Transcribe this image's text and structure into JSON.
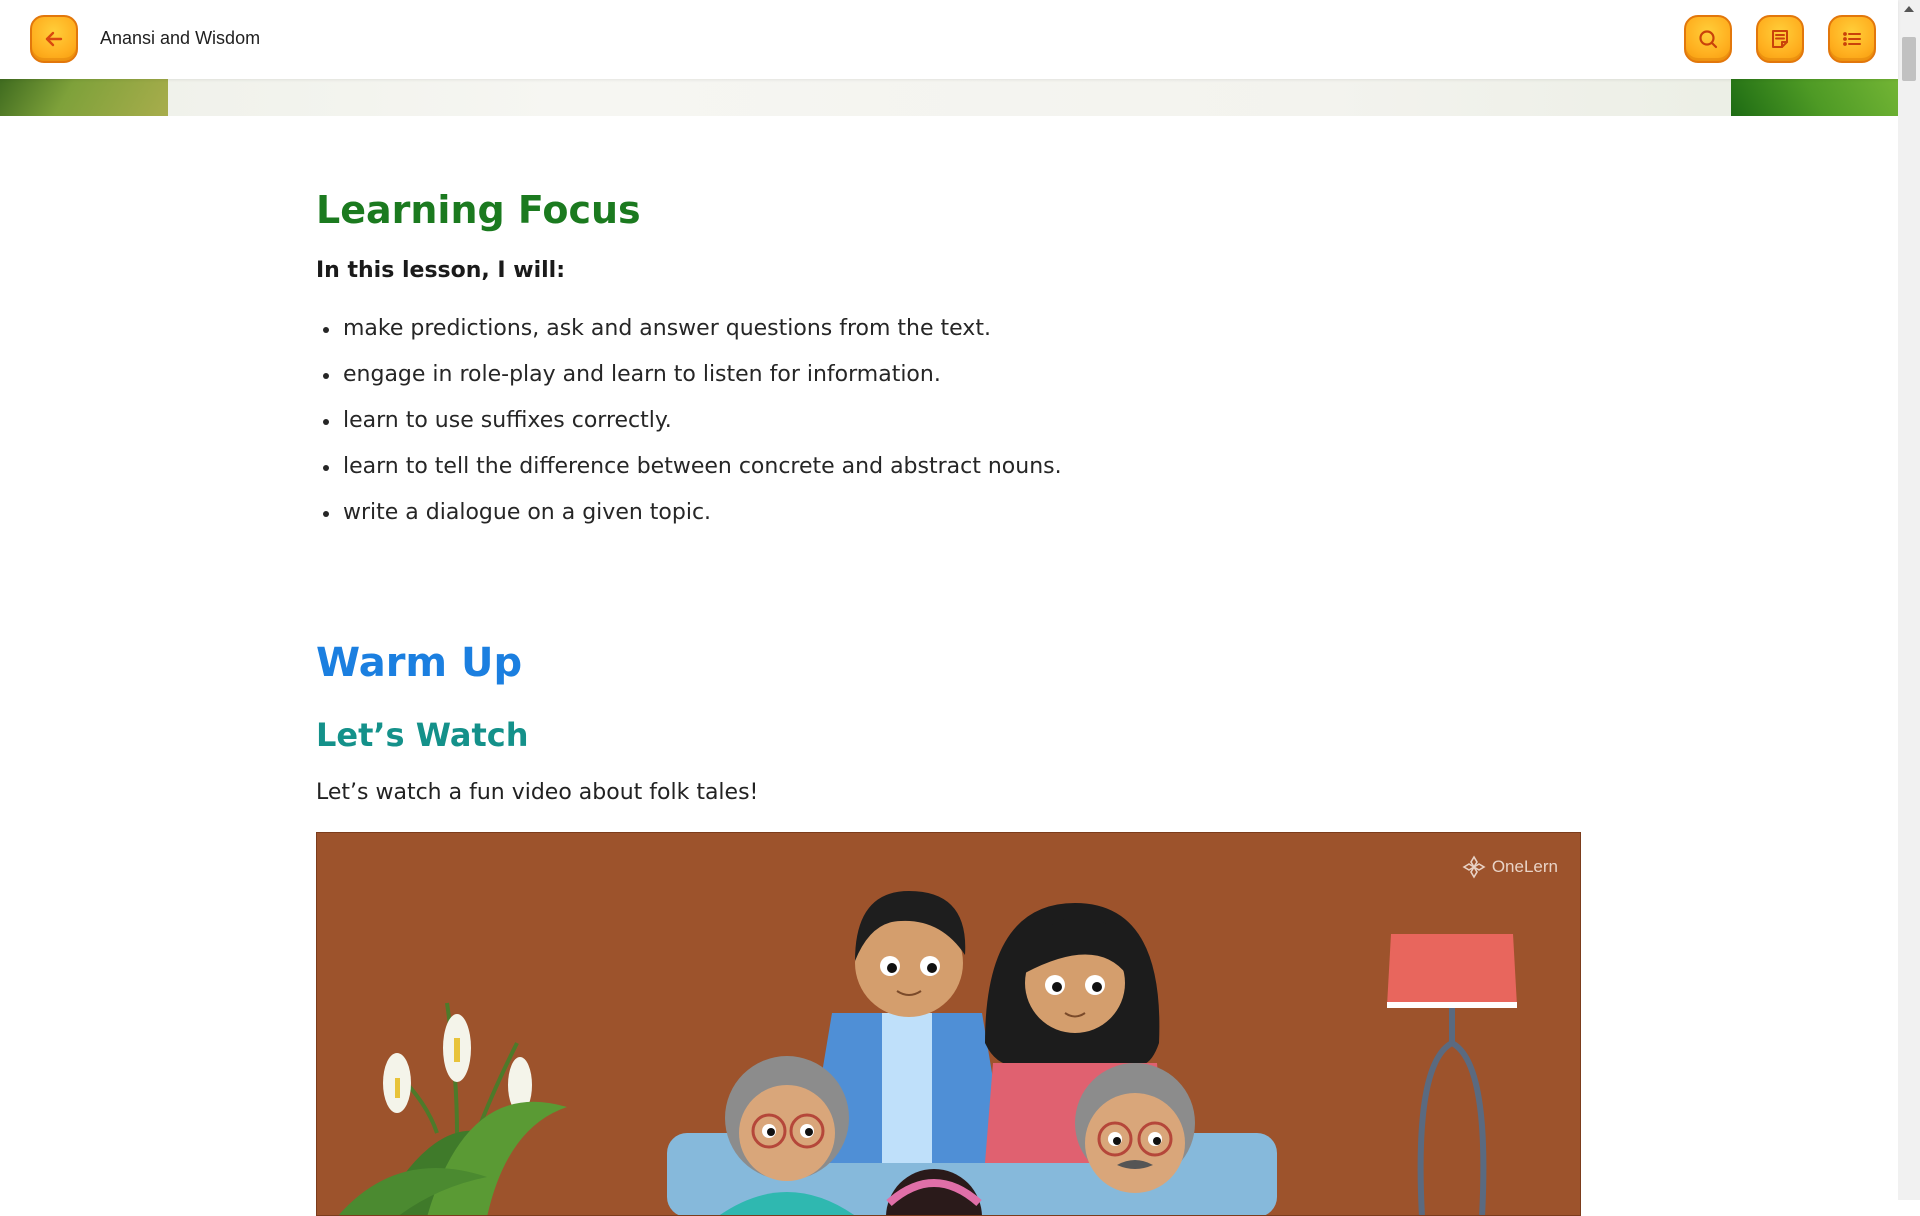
{
  "header": {
    "title": "Anansi and Wisdom",
    "back_icon": "arrow-left-icon",
    "search_icon": "search-icon",
    "notes_icon": "notes-icon",
    "menu_icon": "list-icon"
  },
  "learning_focus": {
    "heading": "Learning Focus",
    "intro": "In this lesson, I will:",
    "items": [
      "make predictions, ask and answer questions from the text.",
      "engage in role-play and learn to listen for information.",
      "learn to use suffixes correctly.",
      "learn to tell the difference between concrete and abstract nouns.",
      "write a dialogue on a given topic."
    ]
  },
  "warm_up": {
    "heading": "Warm Up",
    "subheading": "Let’s Watch",
    "description": "Let’s watch a fun video about folk tales!",
    "video": {
      "brand": "OneLern"
    }
  },
  "colors": {
    "accent_button": "#ffb020",
    "learning_focus_heading": "#1b7a1f",
    "warm_up_heading": "#1b7fe0",
    "lets_watch_heading": "#14918a",
    "video_background": "#9d532c"
  }
}
